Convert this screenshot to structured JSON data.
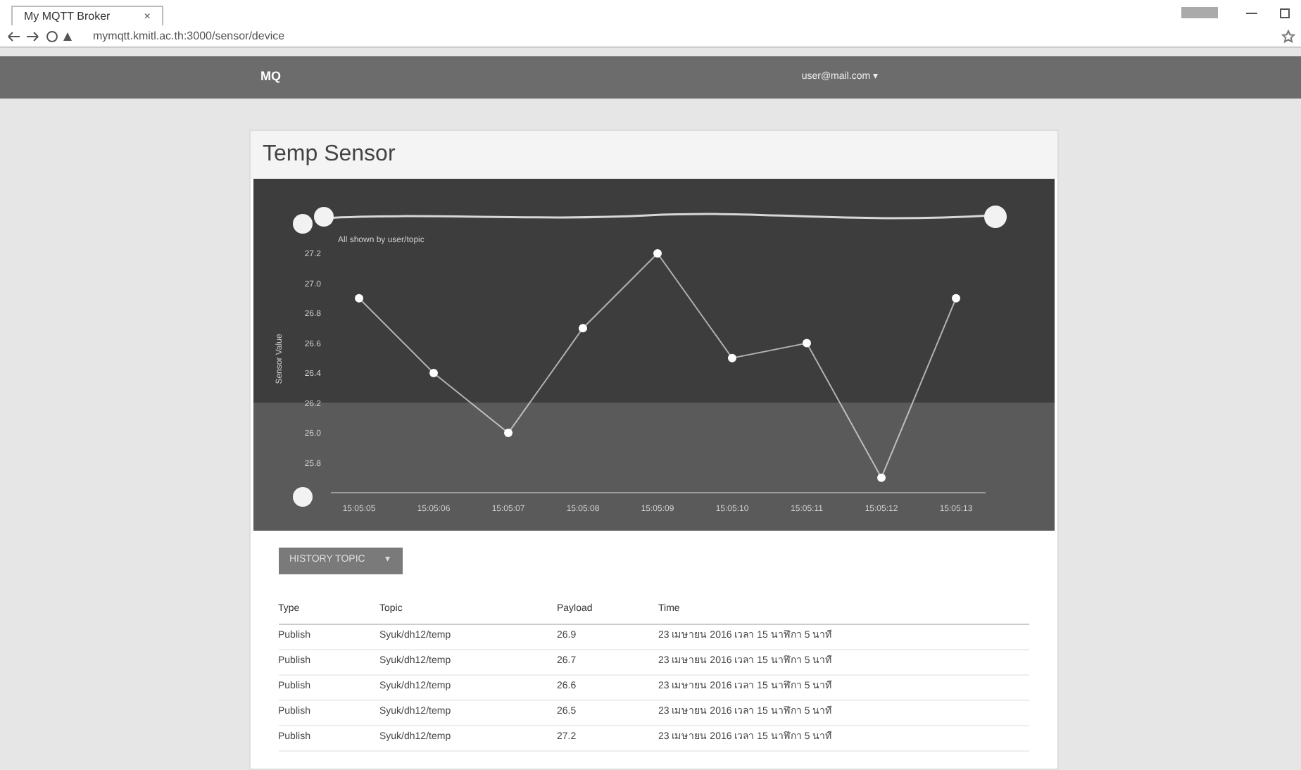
{
  "browser": {
    "tab_title": "My MQTT Broker",
    "tab_close": "×",
    "url": "mymqtt.kmitl.ac.th:3000/sensor/device"
  },
  "navbar": {
    "brand": "MQ",
    "user": "user@mail.com ▾"
  },
  "card": {
    "title": "Temp Sensor",
    "chart": {
      "legend": "All shown by user/topic",
      "chart_data": {
        "type": "line",
        "ylabel": "Sensor Value",
        "categories": [
          "15:05:05",
          "15:05:06",
          "15:05:07",
          "15:05:08",
          "15:05:09",
          "15:05:10",
          "15:05:11",
          "15:05:12",
          "15:05:13"
        ],
        "ylim": [
          25.6,
          27.2
        ],
        "yticks": [
          25.8,
          {
            "value": 26,
            "label": "26.0"
          },
          26.2,
          26.4,
          26.6,
          26.8,
          {
            "value": 27,
            "label": "27.0"
          },
          27.2
        ],
        "marker": "circle",
        "values": [
          26.9,
          26.4,
          26.0,
          26.7,
          27.2,
          26.5,
          26.6,
          25.7,
          26.9
        ]
      }
    },
    "history_button": "HISTORY TOPIC",
    "history_caret": "▾",
    "table": {
      "columns": [
        "Type",
        "Topic",
        "Payload",
        "Time"
      ],
      "rows": [
        [
          "Publish",
          "Syuk/dh12/temp",
          "26.9",
          "23 เมษายน 2016 เวลา 15 นาฬิกา 5 นาที"
        ],
        [
          "Publish",
          "Syuk/dh12/temp",
          "26.7",
          "23 เมษายน 2016 เวลา 15 นาฬิกา 5 นาที"
        ],
        [
          "Publish",
          "Syuk/dh12/temp",
          "26.6",
          "23 เมษายน 2016 เวลา 15 นาฬิกา 5 นาที"
        ],
        [
          "Publish",
          "Syuk/dh12/temp",
          "26.5",
          "23 เมษายน 2016 เวลา 15 นาฬิกา 5 นาที"
        ],
        [
          "Publish",
          "Syuk/dh12/temp",
          "27.2",
          "23 เมษายน 2016 เวลา 15 นาฬิกา 5 นาที"
        ]
      ]
    }
  }
}
